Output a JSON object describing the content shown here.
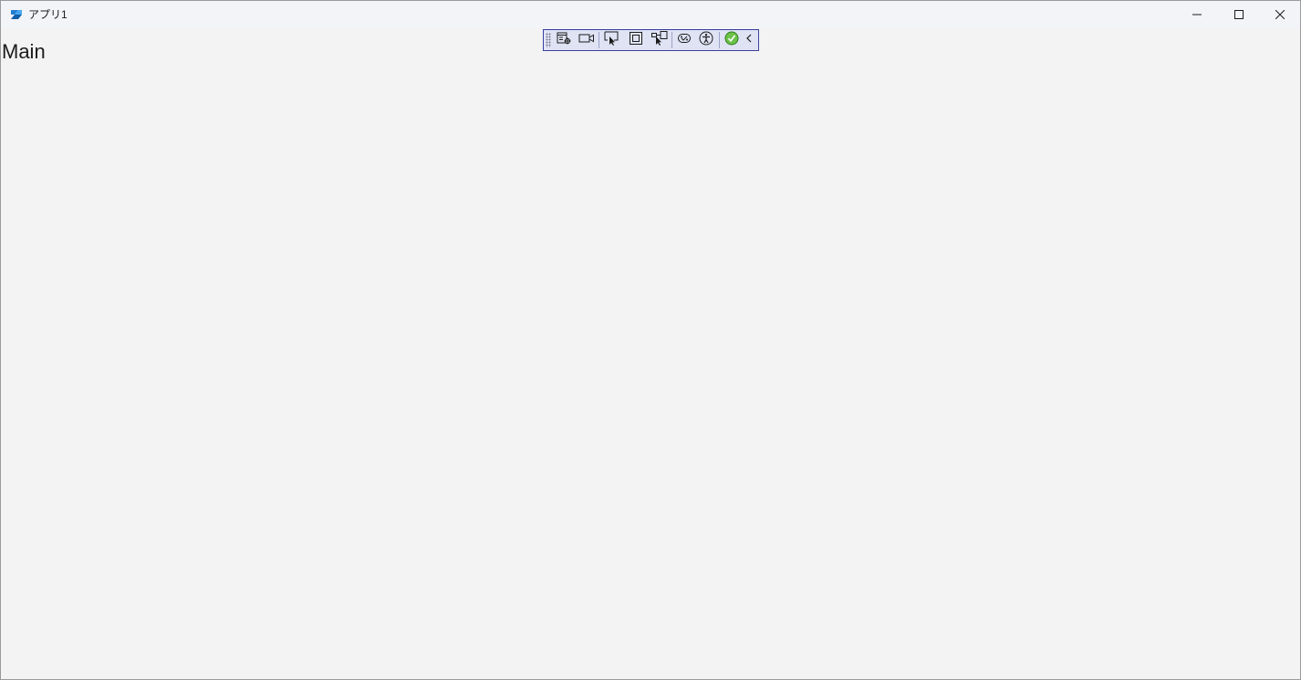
{
  "window": {
    "title": "アプリ1",
    "caption_buttons": [
      "minimize-icon",
      "maximize-icon",
      "close-icon"
    ]
  },
  "main": {
    "page_title": "Main"
  },
  "debug_toolbar": {
    "buttons": [
      "live-visual-tree-icon",
      "record-icon",
      "select-element-icon",
      "display-layout-adorners-icon",
      "track-focus-icon",
      "binding-failures-icon",
      "accessibility-checker-icon",
      "scan-status-icon",
      "collapse-toolbar-icon"
    ],
    "colors": {
      "border": "#3a3fa0",
      "background": "#dfe3f4",
      "status_ok": "#6cc24a"
    }
  },
  "colors": {
    "app_background": "#f3f3f3",
    "titlebar": "#f3f4f8",
    "accent": "#0f6cbd"
  }
}
